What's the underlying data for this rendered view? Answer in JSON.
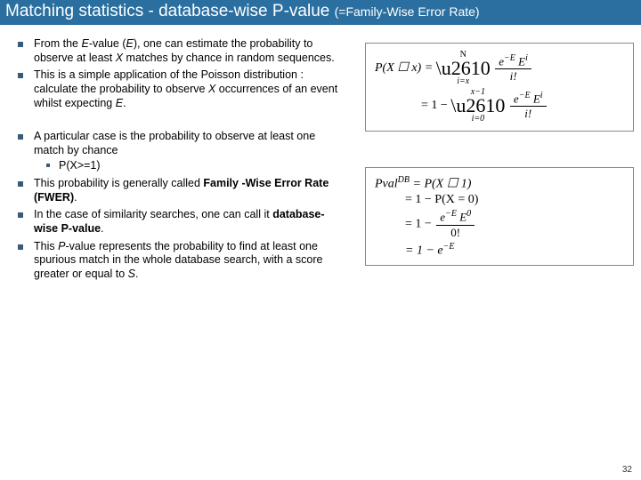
{
  "title": {
    "main": "Matching statistics - database-wise P-value ",
    "sub": "(=Family-Wise Error Rate)"
  },
  "bullets_group1": [
    "From the <span class='ital'>E</span>-value (<span class='ital'>E</span>), one can estimate the probability to observe at least <span class='ital'>X</span> matches by chance in random sequences.",
    "This is a simple application of the Poisson distribution : calculate the probability to observe <span class='ital'>X</span> occurrences of an event whilst expecting <span class='ital'>E</span>."
  ],
  "bullets_group2": [
    {
      "text": "A particular case is the probability to observe at least one match by chance",
      "sub": [
        "P(X>=1)"
      ]
    },
    {
      "text": "This probability is generally called <span class='bold'>Family -Wise Error Rate (FWER)</span>."
    },
    {
      "text": "In the case of similarity searches, one can call it <span class='bold'>database-wise P-value</span>."
    },
    {
      "text": "This <span class='ital'>P</span>-value represents the probability to find at least one spurious match in the whole database search, with a score greater or equal to <span class='ital'>S</span>."
    }
  ],
  "formula1": {
    "line1_left": "P(X ☐ x) = ",
    "sum1_top": "N",
    "sum1_bot": "i=x",
    "frac1_num": "e<span class='sup'>−E</span> E<span class='sup'>i</span>",
    "frac1_den": "i!",
    "line2_left": "= 1 − ",
    "sum2_top": "x−1",
    "sum2_bot": "i=0",
    "frac2_num": "e<span class='sup'>−E</span> E<span class='sup'>i</span>",
    "frac2_den": "i!"
  },
  "formula2": {
    "line1": "Pval<span class='sup'>DB</span> = P(X ☐ 1)",
    "line2_left": "= 1 − P(X = 0)",
    "line3_left": "= 1 − ",
    "frac_num": "e<span class='sup'>−E</span> E<span class='sup'>0</span>",
    "frac_den": "0!",
    "line4": "= 1 − e<span class='sup'>−E</span>"
  },
  "page_number": "32"
}
